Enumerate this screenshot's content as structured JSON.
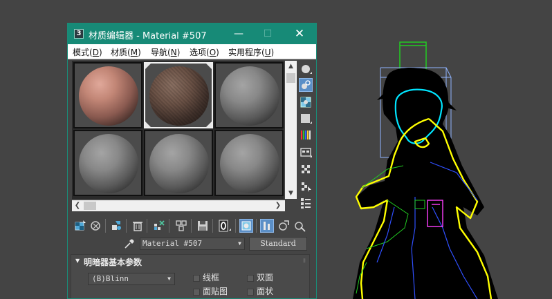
{
  "window": {
    "title": "材质编辑器 - Material #507",
    "app_icon": "3",
    "minimize_icon": "—",
    "maximize_icon": "☐",
    "close_icon": "✕"
  },
  "menu": [
    {
      "label": "模式",
      "key": "D"
    },
    {
      "label": "材质",
      "key": "M"
    },
    {
      "label": "导航",
      "key": "N"
    },
    {
      "label": "选项",
      "key": "O"
    },
    {
      "label": "实用程序",
      "key": "U"
    }
  ],
  "slots": [
    {
      "sphere": "pink-shiny"
    },
    {
      "sphere": "brown-textured",
      "active": true
    },
    {
      "sphere": "gray"
    },
    {
      "sphere": "gray"
    },
    {
      "sphere": "gray"
    },
    {
      "sphere": "gray"
    }
  ],
  "scrollbars": {
    "up_arrow": "▲",
    "down_arrow": "▼",
    "left_arrow": "❮",
    "right_arrow": "❯"
  },
  "material_name": "Material #507",
  "material_type": "Standard",
  "dropdown_caret": "▼",
  "rollout": {
    "toggle": "▼",
    "title": "明暗器基本参数",
    "grip": "⁞⁞",
    "shader": "(B)Blinn",
    "options": [
      {
        "label": "线框",
        "checked": false
      },
      {
        "label": "双面",
        "checked": false
      },
      {
        "label": "面贴图",
        "checked": false
      },
      {
        "label": "面状",
        "checked": false
      }
    ]
  },
  "colors": {
    "titlebar": "#178a77",
    "viewport_bg": "#444444",
    "highlight_tool": "#5b8fc7",
    "wire_yellow": "#ffff00",
    "wire_cyan": "#00e5ff",
    "wire_green": "#22cc22",
    "wire_blue": "#3050ff",
    "wire_magenta": "#ff40ff"
  }
}
